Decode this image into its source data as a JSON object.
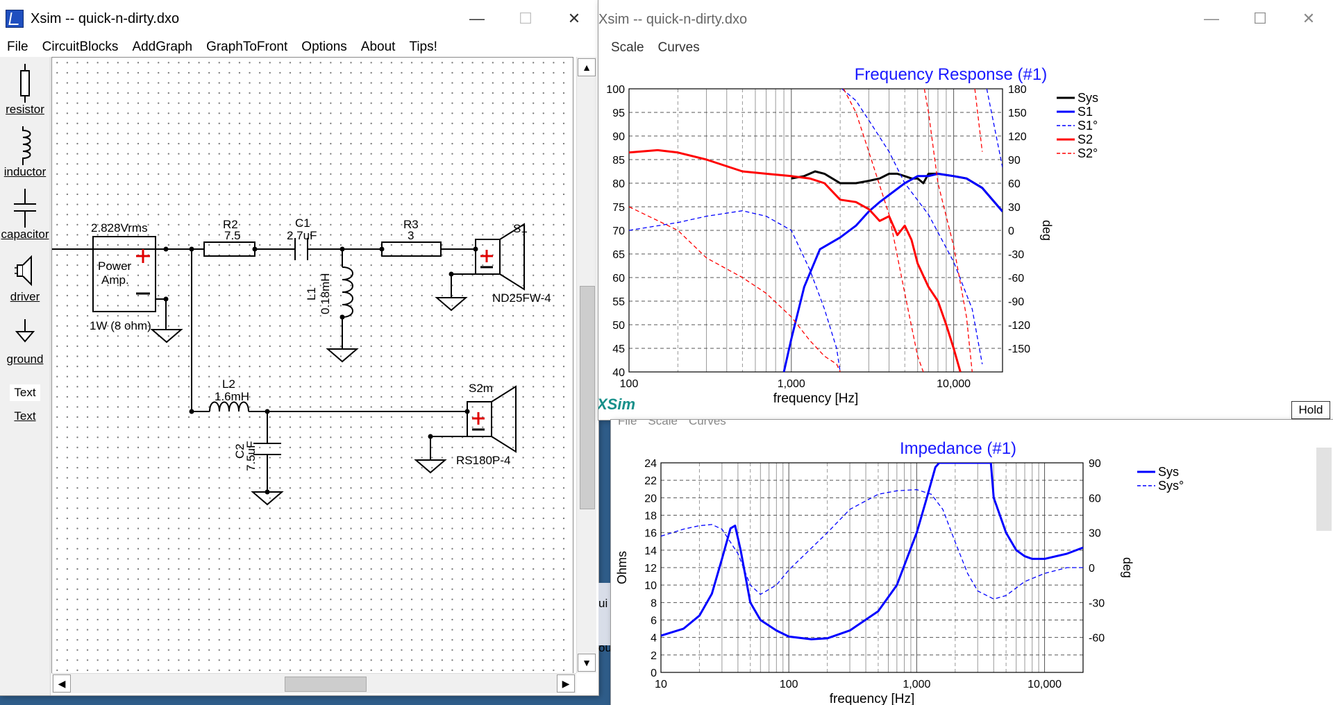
{
  "left_window": {
    "title": "Xsim -- quick-n-dirty.dxo",
    "controls": [
      "—",
      "☐",
      "✕"
    ],
    "menu": [
      "File",
      "CircuitBlocks",
      "AddGraph",
      "GraphToFront",
      "Options",
      "About",
      "Tips!"
    ]
  },
  "palette": {
    "items": [
      "resistor",
      "inductor",
      "capacitor",
      "driver",
      "ground",
      "Text"
    ],
    "text_sample": "Text"
  },
  "schematic": {
    "source_voltage": "2.828Vrms",
    "amp_line1": "Power",
    "amp_line2": "Amp.",
    "amp_power": "1W (8 ohm)",
    "r2_name": "R2",
    "r2_value": "7.5",
    "c1_name": "C1",
    "c1_value": "2.7uF",
    "r3_name": "R3",
    "r3_value": "3",
    "l1_name": "L1",
    "l1_value": "0.18mH",
    "l2_name": "L2",
    "l2_value": "1.6mH",
    "c2_name": "C2",
    "c2_value": "7.5uF",
    "s1_name": "S1",
    "s1_model": "ND25FW-4",
    "s2_name": "S2m",
    "s2_model": "RS180P-4"
  },
  "fr_window": {
    "title": "Xsim -- quick-n-dirty.dxo",
    "controls": [
      "—",
      "☐",
      "✕"
    ],
    "menu": [
      "Scale",
      "Curves"
    ],
    "graph_title": "Frequency Response (#1)",
    "xlabel": "frequency [Hz]",
    "right_axis_label": "deg",
    "logo": "XSim",
    "hold_label": "Hold",
    "legend": [
      {
        "name": "Sys",
        "color": "#000000",
        "dash": "solid"
      },
      {
        "name": "S1",
        "color": "#0000ff",
        "dash": "solid"
      },
      {
        "name": "S1°",
        "color": "#0000ff",
        "dash": "dashed"
      },
      {
        "name": "S2",
        "color": "#ff0000",
        "dash": "solid"
      },
      {
        "name": "S2°",
        "color": "#ff0000",
        "dash": "dashed"
      }
    ],
    "y_ticks": [
      "100",
      "95",
      "90",
      "85",
      "80",
      "75",
      "70",
      "65",
      "60",
      "55",
      "50",
      "45",
      "40"
    ],
    "y2_ticks": [
      "180",
      "150",
      "120",
      "90",
      "60",
      "30",
      "0",
      "-30",
      "-60",
      "-90",
      "-120",
      "-150"
    ],
    "x_ticks": [
      "100",
      "1,000",
      "10,000"
    ]
  },
  "imp_window": {
    "menu_peek": [
      "File",
      "Scale",
      "Curves"
    ],
    "graph_title": "Impedance (#1)",
    "xlabel": "frequency [Hz]",
    "ylabel": "Ohms",
    "right_axis_label": "deg",
    "logo": "XSim",
    "legend": [
      {
        "name": "Sys",
        "color": "#0000ff",
        "dash": "solid"
      },
      {
        "name": "Sys°",
        "color": "#0000ff",
        "dash": "dashed"
      }
    ],
    "y_ticks": [
      "24",
      "22",
      "20",
      "18",
      "16",
      "14",
      "12",
      "10",
      "8",
      "6",
      "4",
      "2",
      "0"
    ],
    "y2_ticks": [
      "90",
      "60",
      "30",
      "0",
      "-30",
      "-60"
    ],
    "x_ticks": [
      "10",
      "100",
      "1,000",
      "10,000"
    ]
  },
  "background_peek": [
    "ui",
    "ou"
  ],
  "chart_data": [
    {
      "type": "line",
      "title": "Frequency Response (#1)",
      "xlabel": "frequency [Hz]",
      "ylabel": "",
      "y2label": "deg",
      "xscale": "log",
      "xlim": [
        100,
        20000
      ],
      "ylim": [
        40,
        100
      ],
      "y2lim": [
        -180,
        180
      ],
      "grid": true,
      "legend_position": "right",
      "series": [
        {
          "name": "Sys",
          "axis": "left",
          "x": [
            1000,
            1200,
            1400,
            1600,
            2000,
            2500,
            3000,
            3500,
            4000,
            4500,
            5000,
            5500,
            6000,
            6500,
            7000,
            8000,
            10000,
            12000,
            15000,
            20000
          ],
          "y": [
            81,
            81.5,
            82.5,
            82,
            80,
            80,
            80.5,
            81,
            82,
            82,
            81.5,
            81,
            81,
            80,
            82,
            82,
            81.5,
            81,
            79,
            74
          ]
        },
        {
          "name": "S1",
          "axis": "left",
          "x": [
            900,
            1000,
            1200,
            1500,
            2000,
            2500,
            3000,
            3500,
            4000,
            5000,
            6000,
            7000,
            8000,
            10000,
            12000,
            15000,
            20000
          ],
          "y": [
            40,
            47,
            58,
            66,
            68.5,
            71,
            74,
            76,
            77.5,
            80,
            81.5,
            81.5,
            82,
            81.5,
            81,
            79,
            74
          ]
        },
        {
          "name": "S1°",
          "axis": "right",
          "x": [
            100,
            200,
            300,
            500,
            700,
            1000,
            1300,
            1600,
            1900,
            2000,
            2050,
            2500,
            3000,
            4000,
            5000,
            7000,
            10000,
            13000,
            15000,
            16000,
            20000
          ],
          "y": [
            0,
            10,
            18,
            25,
            18,
            0,
            -50,
            -100,
            -150,
            -180,
            180,
            165,
            140,
            100,
            60,
            20,
            -40,
            -100,
            -170,
            180,
            80
          ]
        },
        {
          "name": "S2",
          "axis": "left",
          "x": [
            100,
            150,
            200,
            300,
            500,
            700,
            1000,
            1300,
            1600,
            2000,
            2500,
            3000,
            3500,
            4000,
            4500,
            5000,
            5500,
            6000,
            7000,
            8000,
            9000,
            10000,
            11000
          ],
          "y": [
            86.5,
            87,
            86.5,
            85,
            82.5,
            82,
            81.5,
            81,
            80,
            76.5,
            76,
            74.5,
            72,
            73,
            69,
            71,
            68,
            63,
            58,
            55,
            50,
            45,
            40
          ]
        },
        {
          "name": "S2°",
          "axis": "right",
          "x": [
            100,
            200,
            300,
            500,
            700,
            1000,
            1300,
            1600,
            1900,
            2000,
            2100,
            2500,
            3000,
            4000,
            5000,
            6000,
            6500,
            6600,
            7000,
            8000,
            10000,
            12000,
            13000,
            13500,
            15000
          ],
          "y": [
            30,
            0,
            -35,
            -60,
            -80,
            -110,
            -140,
            -160,
            -170,
            -180,
            180,
            150,
            100,
            20,
            -80,
            -160,
            -180,
            180,
            150,
            60,
            -20,
            -110,
            -180,
            180,
            100
          ]
        }
      ]
    },
    {
      "type": "line",
      "title": "Impedance (#1)",
      "xlabel": "frequency [Hz]",
      "ylabel": "Ohms",
      "y2label": "deg",
      "xscale": "log",
      "xlim": [
        10,
        20000
      ],
      "ylim": [
        0,
        24
      ],
      "y2lim": [
        -90,
        90
      ],
      "grid": true,
      "legend_position": "right",
      "series": [
        {
          "name": "Sys",
          "axis": "left",
          "x": [
            10,
            15,
            20,
            25,
            30,
            35,
            38,
            42,
            50,
            60,
            80,
            100,
            150,
            200,
            300,
            500,
            700,
            1000,
            1200,
            1400,
            1500,
            3800,
            4000,
            5000,
            6000,
            7000,
            8000,
            10000,
            15000,
            20000
          ],
          "y": [
            4.2,
            5,
            6.5,
            9,
            13,
            16.5,
            16.8,
            14,
            8,
            6,
            4.8,
            4.1,
            3.8,
            3.9,
            4.8,
            7,
            10,
            16,
            20,
            23.5,
            24,
            24,
            20,
            16,
            14,
            13.3,
            13,
            13,
            13.6,
            14.3
          ]
        },
        {
          "name": "Sys°",
          "axis": "right",
          "x": [
            10,
            15,
            20,
            25,
            30,
            40,
            50,
            60,
            80,
            100,
            200,
            300,
            500,
            700,
            1000,
            1300,
            1600,
            2000,
            2500,
            3000,
            4000,
            5000,
            7000,
            10000,
            15000,
            20000
          ],
          "y": [
            27,
            33,
            36,
            37,
            33,
            12,
            -15,
            -23,
            -15,
            -2,
            30,
            50,
            63,
            66,
            67,
            63,
            50,
            22,
            -5,
            -20,
            -27,
            -24,
            -12,
            -5,
            0,
            0
          ]
        }
      ]
    }
  ]
}
